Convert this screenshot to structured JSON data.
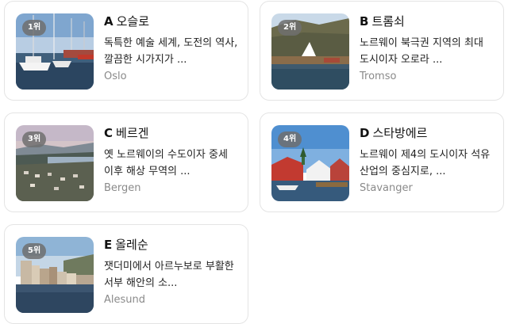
{
  "cities": [
    {
      "rank": "1위",
      "letter": "A",
      "name": "오슬로",
      "description": "독특한 예술 세계, 도전의 역사, 깔끔한 시가지가 ...",
      "english": "Oslo"
    },
    {
      "rank": "2위",
      "letter": "B",
      "name": "트롬쇠",
      "description": "노르웨이 북극권 지역의 최대 도시이자 오로라 ...",
      "english": "Tromso"
    },
    {
      "rank": "3위",
      "letter": "C",
      "name": "베르겐",
      "description": "옛 노르웨이의 수도이자 중세 이후 해상 무역의 ...",
      "english": "Bergen"
    },
    {
      "rank": "4위",
      "letter": "D",
      "name": "스타방에르",
      "description": "노르웨이 제4의 도시이자 석유 산업의 중심지로, ...",
      "english": "Stavanger"
    },
    {
      "rank": "5위",
      "letter": "E",
      "name": "올레순",
      "description": "잿더미에서 아르누보로 부활한 서부 해안의 소...",
      "english": "Alesund"
    }
  ]
}
